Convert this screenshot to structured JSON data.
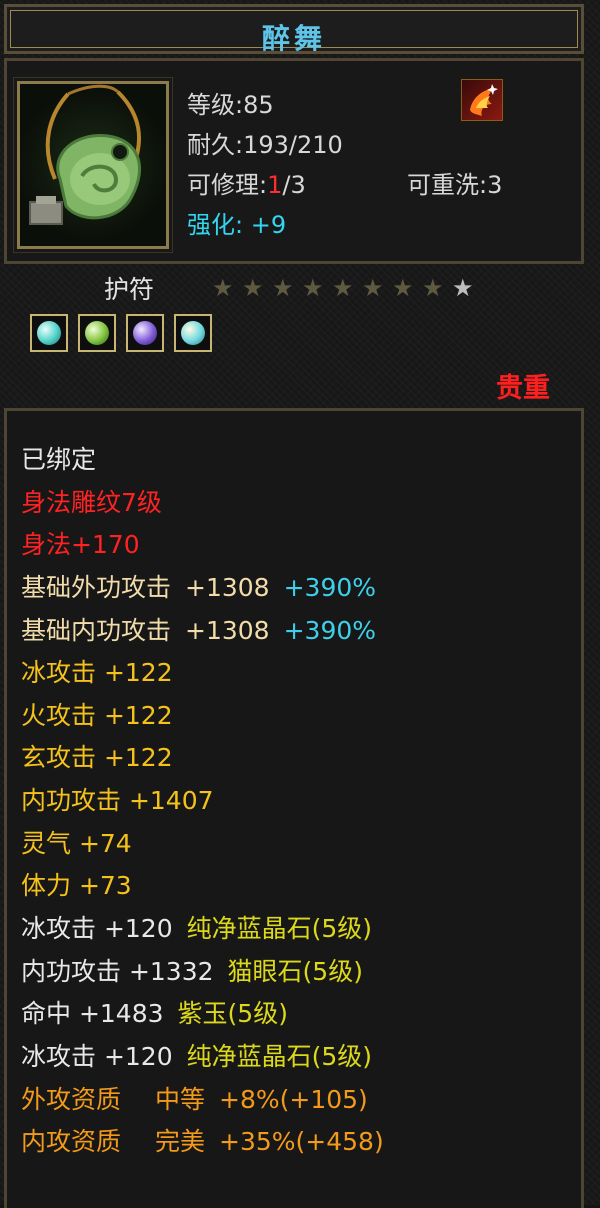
{
  "item": {
    "name": "醉舞",
    "level_label": "等级:85",
    "durability_label": "耐久:193/210",
    "repair_prefix": "可修理:",
    "repair_used": "1",
    "repair_suffix": "/3",
    "rewash_label": "可重洗:3",
    "enhance_label": "强化: +9",
    "type_label": "护符",
    "rarity": "贵重",
    "stars_total": 9,
    "stars_filled": 8,
    "icon": "jade-pendant-icon",
    "element_icon": "fire-phoenix-icon",
    "gems": [
      {
        "name": "cyan-gem-icon",
        "color": "#4fd0c8"
      },
      {
        "name": "green-gem-icon",
        "color": "#7fc23a"
      },
      {
        "name": "purple-gem-icon",
        "color": "#7f5ad6"
      },
      {
        "name": "cyan-gem-icon",
        "color": "#6ed8e0"
      }
    ]
  },
  "attributes": {
    "bound": "已绑定",
    "engrave": "身法雕纹7级",
    "agility": "身法+170",
    "base_ext_name": "基础外功攻击",
    "base_ext_value": "+1308",
    "base_ext_pct": "+390%",
    "base_int_name": "基础内功攻击",
    "base_int_value": "+1308",
    "base_int_pct": "+390%",
    "ice_atk": "冰攻击 +122",
    "fire_atk": "火攻击 +122",
    "xuan_atk": "玄攻击 +122",
    "int_atk": "内功攻击 +1407",
    "spirit": "灵气 +74",
    "stamina": "体力 +73",
    "gem1_stat": "冰攻击 +120",
    "gem1_name": "纯净蓝晶石(5级)",
    "gem2_stat": "内功攻击 +1332",
    "gem2_name": "猫眼石(5级)",
    "gem3_stat": "命中 +1483",
    "gem3_name": "紫玉(5级)",
    "gem4_stat": "冰攻击 +120",
    "gem4_name": "纯净蓝晶石(5级)",
    "ext_quality_label": "外攻资质",
    "ext_quality_grade": "中等",
    "ext_quality_value": "+8%(+105)",
    "int_quality_label": "内攻资质",
    "int_quality_grade": "完美",
    "int_quality_value": "+35%(+458)"
  },
  "colors": {
    "title": "#5ec4e8",
    "red": "#ff2222",
    "cyan": "#3ed0ea",
    "yellow": "#f4c21b",
    "orange": "#f39a1a",
    "star_filled": "#5d5a40",
    "star_empty": "#bdbdbd"
  }
}
